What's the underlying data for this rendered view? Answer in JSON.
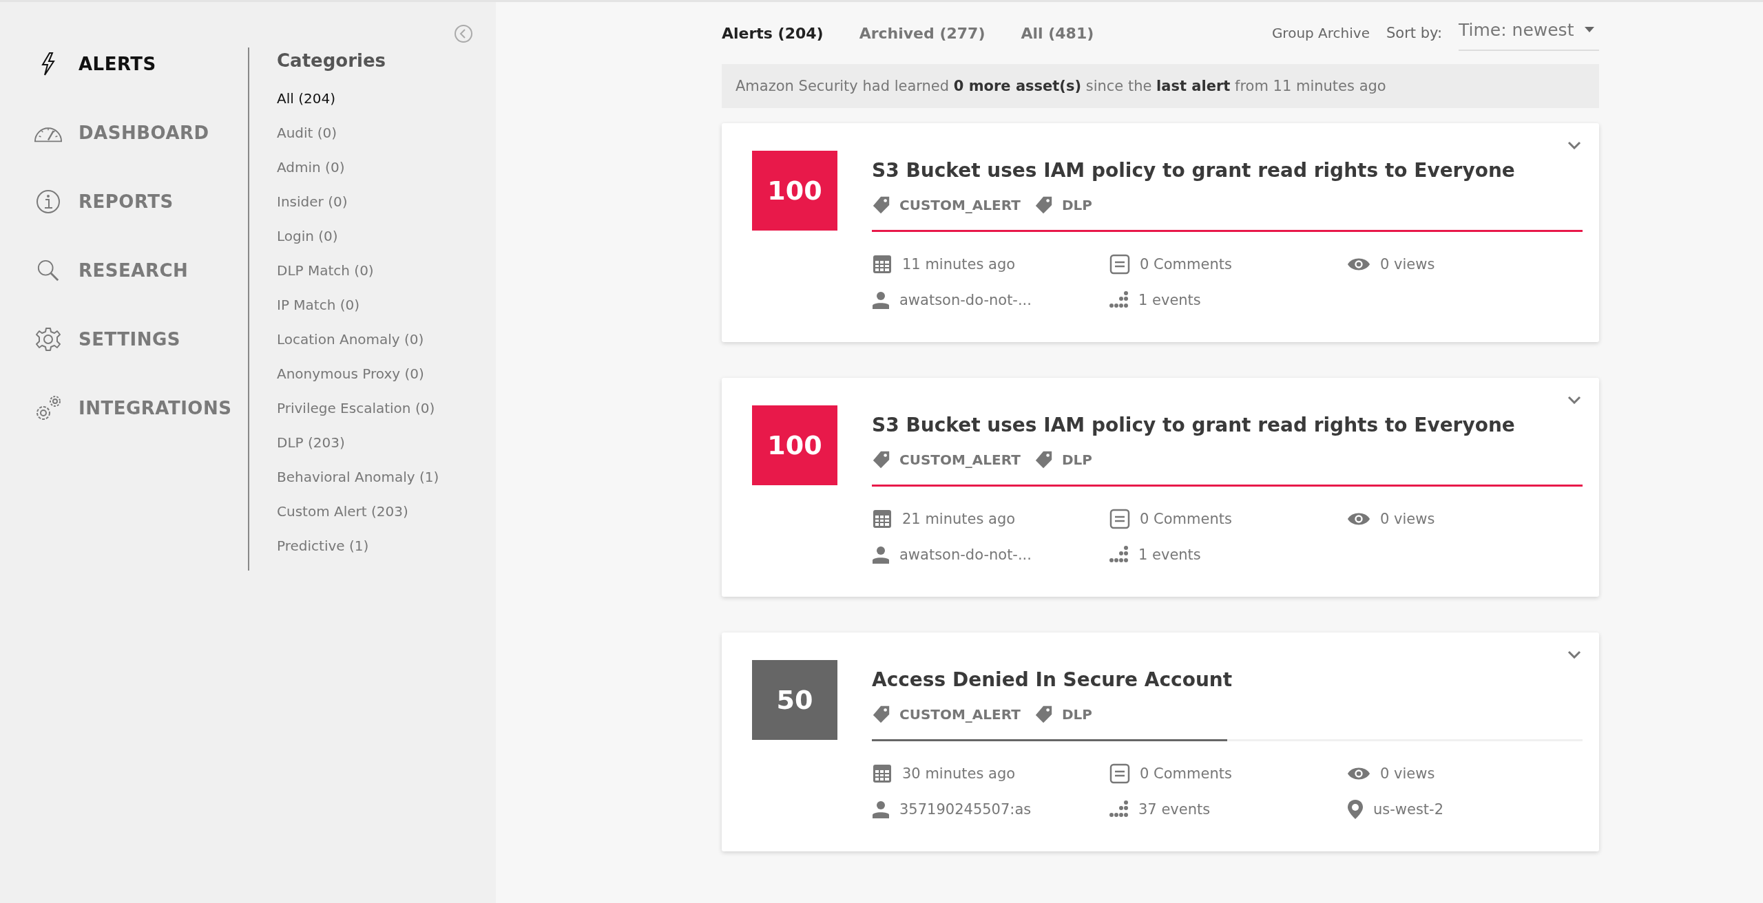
{
  "nav": [
    {
      "label": "ALERTS",
      "kind": "bolt",
      "selected": true
    },
    {
      "label": "DASHBOARD",
      "kind": "gauge",
      "selected": false
    },
    {
      "label": "REPORTS",
      "kind": "info",
      "selected": false
    },
    {
      "label": "RESEARCH",
      "kind": "search",
      "selected": false
    },
    {
      "label": "SETTINGS",
      "kind": "gear",
      "selected": false
    },
    {
      "label": "INTEGRATIONS",
      "kind": "gears",
      "selected": false
    }
  ],
  "categories": {
    "title": "Categories",
    "items": [
      {
        "label": "All (204)",
        "selected": true
      },
      {
        "label": "Audit (0)",
        "selected": false
      },
      {
        "label": "Admin (0)",
        "selected": false
      },
      {
        "label": "Insider (0)",
        "selected": false
      },
      {
        "label": "Login (0)",
        "selected": false
      },
      {
        "label": "DLP Match (0)",
        "selected": false
      },
      {
        "label": "IP Match (0)",
        "selected": false
      },
      {
        "label": "Location Anomaly (0)",
        "selected": false
      },
      {
        "label": "Anonymous Proxy (0)",
        "selected": false
      },
      {
        "label": "Privilege Escalation (0)",
        "selected": false
      },
      {
        "label": "DLP (203)",
        "selected": false
      },
      {
        "label": "Behavioral Anomaly (1)",
        "selected": false
      },
      {
        "label": "Custom Alert (203)",
        "selected": false
      },
      {
        "label": "Predictive (1)",
        "selected": false
      }
    ]
  },
  "tabs": [
    {
      "label": "Alerts (204)",
      "selected": true
    },
    {
      "label": "Archived (277)",
      "selected": false
    },
    {
      "label": "All (481)",
      "selected": false
    }
  ],
  "group_archive": "Group Archive",
  "sort": {
    "label": "Sort by:",
    "value": "Time: newest"
  },
  "banner": "Amazon Security had learned **0 more asset(s)** since the **last alert** from 11 minutes ago",
  "alerts": [
    {
      "score": "100",
      "color": "#e8194a",
      "title": "S3 Bucket uses IAM policy to grant read rights to Everyone",
      "tags": [
        "CUSTOM_ALERT",
        "DLP"
      ],
      "level": 1,
      "meta": [
        {
          "kind": "time",
          "text": "11 minutes ago"
        },
        {
          "kind": "comments",
          "text": "0 Comments"
        },
        {
          "kind": "views",
          "text": "0 views"
        },
        {
          "kind": "user",
          "text": "awatson-do-not-..."
        },
        {
          "kind": "events",
          "text": "1 events"
        }
      ]
    },
    {
      "score": "100",
      "color": "#e8194a",
      "title": "S3 Bucket uses IAM policy to grant read rights to Everyone",
      "tags": [
        "CUSTOM_ALERT",
        "DLP"
      ],
      "level": 1,
      "meta": [
        {
          "kind": "time",
          "text": "21 minutes ago"
        },
        {
          "kind": "comments",
          "text": "0 Comments"
        },
        {
          "kind": "views",
          "text": "0 views"
        },
        {
          "kind": "user",
          "text": "awatson-do-not-..."
        },
        {
          "kind": "events",
          "text": "1 events"
        }
      ]
    },
    {
      "score": "50",
      "color": "#666666",
      "title": "Access Denied In Secure Account",
      "tags": [
        "CUSTOM_ALERT",
        "DLP"
      ],
      "level": 0.5,
      "meta": [
        {
          "kind": "time",
          "text": "30 minutes ago"
        },
        {
          "kind": "comments",
          "text": "0 Comments"
        },
        {
          "kind": "views",
          "text": "0 views"
        },
        {
          "kind": "user",
          "text": "357190245507:as"
        },
        {
          "kind": "events",
          "text": "37 events"
        },
        {
          "kind": "location",
          "text": "us-west-2"
        }
      ]
    }
  ]
}
